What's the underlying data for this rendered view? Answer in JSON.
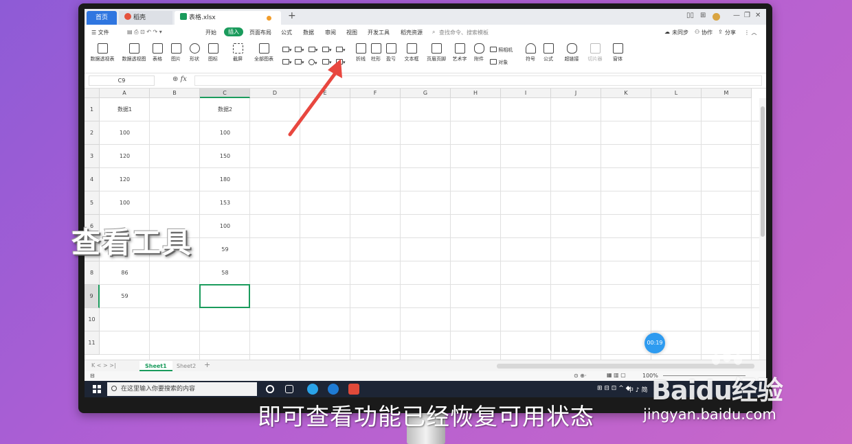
{
  "tabs": {
    "home": "首页",
    "daoke": "稻壳",
    "file": "表格.xlsx",
    "plus": "+"
  },
  "window_controls": [
    "—",
    "❐",
    "✕"
  ],
  "menu": {
    "file": "☰ 文件",
    "items": [
      "开始",
      "插入",
      "页面布局",
      "公式",
      "数据",
      "审阅",
      "视图",
      "开发工具",
      "稻壳资源"
    ],
    "search": "查找命令、搜索模板",
    "unsync": "未同步",
    "collab": "协作",
    "share": "分享"
  },
  "ribbon": {
    "pivot_table": "数据透视表",
    "pivot_chart": "数据透视图",
    "table": "表格",
    "picture": "图片",
    "shape": "形状",
    "icon": "图标",
    "screenshot": "截屏",
    "all_charts": "全部图表",
    "line": "折线",
    "column": "柱形",
    "winloss": "盈亏",
    "textbox": "文本框",
    "header_footer": "页眉页脚",
    "wordart": "艺术字",
    "attachment": "附件",
    "camera": "照相机",
    "object": "对象",
    "symbol": "符号",
    "formula": "公式",
    "hyperlink": "超链接",
    "slicer": "切片器",
    "form": "窗体"
  },
  "formula_bar": {
    "name_box": "C9",
    "fx": "fx"
  },
  "columns": [
    "A",
    "B",
    "C",
    "D",
    "E",
    "F",
    "G",
    "H",
    "I",
    "J",
    "K",
    "L",
    "M"
  ],
  "rows": [
    "1",
    "2",
    "3",
    "4",
    "5",
    "6",
    "7",
    "8",
    "9",
    "10",
    "11"
  ],
  "column_a": [
    "数据1",
    "100",
    "120",
    "120",
    "100",
    "",
    "",
    "86",
    "59",
    "",
    ""
  ],
  "column_c": [
    "数据2",
    "100",
    "150",
    "180",
    "153",
    "100",
    "59",
    "58",
    "",
    "",
    ""
  ],
  "sheets": [
    "Sheet1",
    "Sheet2"
  ],
  "status": {
    "zoom": "100%"
  },
  "taskbar": {
    "search_placeholder": "在这里输入你要搜索的内容",
    "tray_text": "中 ♪ 简"
  },
  "overlay": {
    "timer": "00:19",
    "caption_left": "查看工具",
    "subtitle": "即可查看功能已经恢复可用状态",
    "watermark": "Baidu经验",
    "watermark_url": "jingyan.baidu.com"
  },
  "colors": {
    "accent": "#1a9b5c",
    "tab_home": "#2f76e0",
    "arrow": "#e8473f",
    "timer": "#2e9bf0"
  }
}
